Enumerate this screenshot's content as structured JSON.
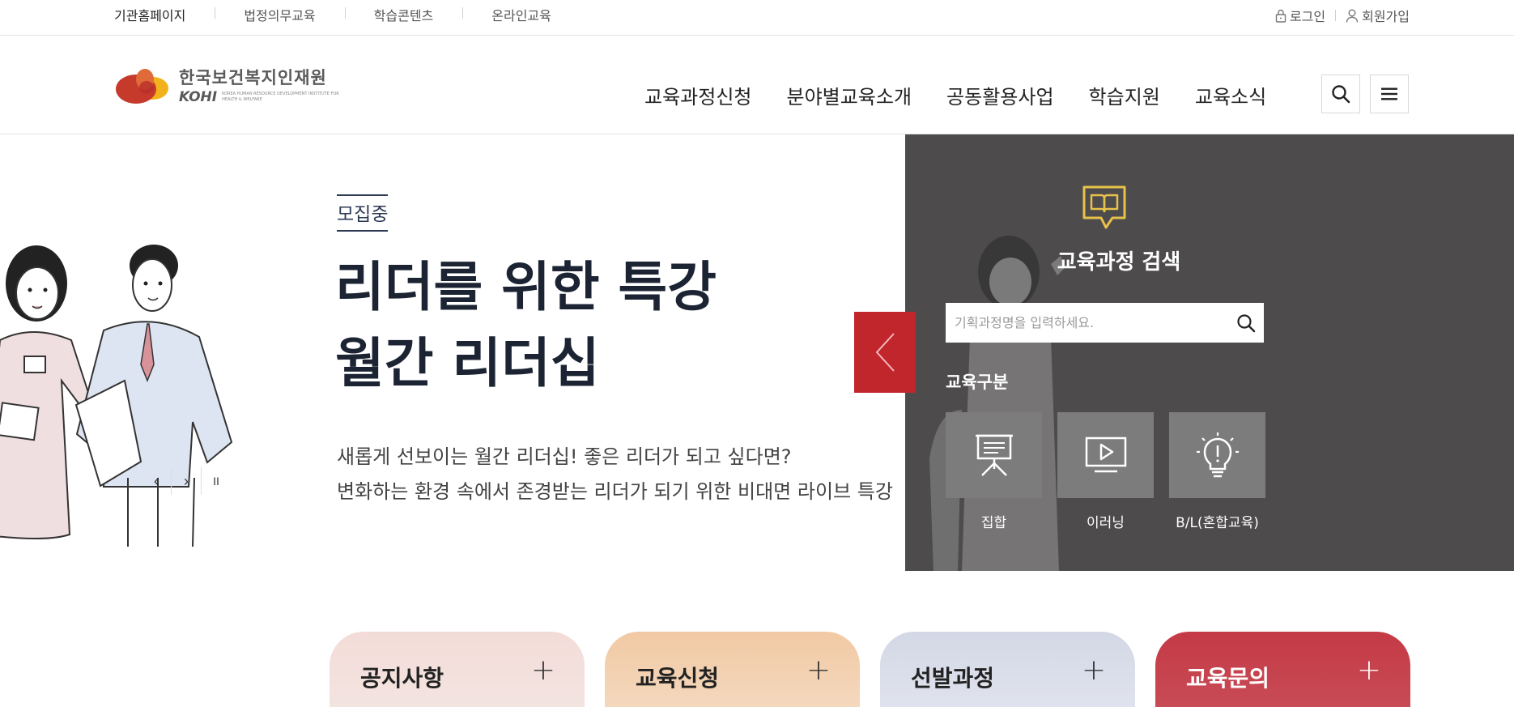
{
  "util_bar": {
    "links": [
      "기관홈페이지",
      "법정의무교육",
      "학습콘텐츠",
      "온라인교육"
    ],
    "login": "로그인",
    "join": "회원가입"
  },
  "header": {
    "logo_ko": "한국보건복지인재원",
    "logo_en": "KOHI",
    "logo_sub": "KOREA HUMAN RESOURCE DEVELOPMENT INSTITUTE FOR HEALTH & WELFARE",
    "nav": [
      "교육과정신청",
      "분야별교육소개",
      "공동활용사업",
      "학습지원",
      "교육소식"
    ],
    "search_icon": "search-icon",
    "menu_icon": "hamburger-menu-icon"
  },
  "hero": {
    "badge": "모집중",
    "title_line1": "리더를 위한 특강",
    "title_line2": "월간 리더십",
    "desc_line1": "새롭게 선보이는 월간 리더십! 좋은 리더가 되고 싶다면?",
    "desc_line2": "변화하는 환경 속에서 존경받는 리더가 되기 위한 비대면 라이브 특강",
    "controls": {
      "prev": "‹",
      "next": "›",
      "pause": "II"
    }
  },
  "search_panel": {
    "title": "교육과정 검색",
    "placeholder": "기획과정명을 입력하세요.",
    "type_label": "교육구분",
    "types": [
      {
        "icon": "presentation-board-icon",
        "label": "집합"
      },
      {
        "icon": "video-play-icon",
        "label": "이러닝"
      },
      {
        "icon": "lightbulb-icon",
        "label": "B/L(혼합교육)"
      }
    ]
  },
  "quick_cards": [
    {
      "title": "공지사항",
      "plus": "+"
    },
    {
      "title": "교육신청",
      "plus": "+"
    },
    {
      "title": "선발과정",
      "plus": "+"
    },
    {
      "title": "교육문의",
      "plus": "+"
    }
  ],
  "colors": {
    "accent_red": "#c2262d",
    "panel_dark": "#4d4b4c",
    "book_icon_yellow": "#e8c14a",
    "card_notice": "#f3dcd8",
    "card_apply": "#f1c9a4",
    "card_select": "#d4d8e6",
    "card_inquiry": "#c43a45"
  }
}
